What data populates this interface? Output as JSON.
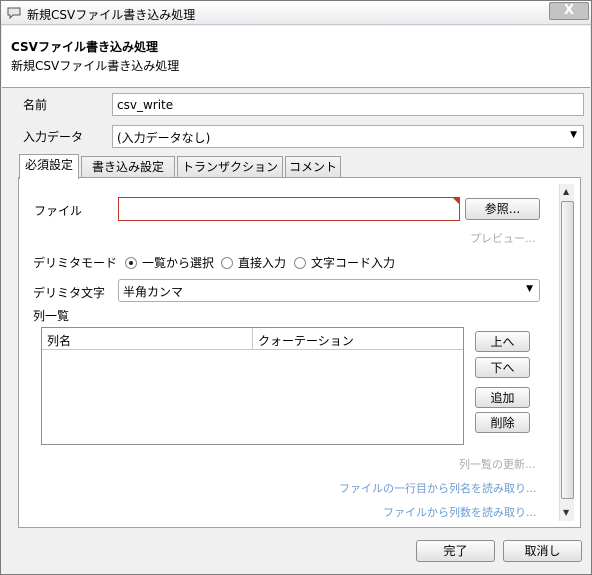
{
  "window": {
    "title": "新規CSVファイル書き込み処理",
    "close_label": "X"
  },
  "banner": {
    "title": "CSVファイル書き込み処理",
    "subtitle": "新規CSVファイル書き込み処理"
  },
  "form": {
    "name_label": "名前",
    "name_value": "csv_write",
    "input_data_label": "入力データ",
    "input_data_value": "(入力データなし)"
  },
  "tabs": [
    {
      "label": "必須設定",
      "active": true
    },
    {
      "label": "書き込み設定",
      "active": false
    },
    {
      "label": "トランザクション",
      "active": false
    },
    {
      "label": "コメント",
      "active": false
    }
  ],
  "required": {
    "file_label": "ファイル",
    "file_value": "",
    "browse_label": "参照...",
    "preview_label": "プレビュー...",
    "delimiter_mode_label": "デリミタモード",
    "radio_options": [
      {
        "label": "一覧から選択",
        "selected": true
      },
      {
        "label": "直接入力",
        "selected": false
      },
      {
        "label": "文字コード入力",
        "selected": false
      }
    ],
    "delimiter_char_label": "デリミタ文字",
    "delimiter_char_value": "半角カンマ",
    "column_list_label": "列一覧",
    "columns": [
      "列名",
      "クォーテーション"
    ],
    "up_label": "上へ",
    "down_label": "下へ",
    "add_label": "追加",
    "delete_label": "削除",
    "refresh_list_label": "列一覧の更新...",
    "read_names_label": "ファイルの一行目から列名を読み取り...",
    "read_count_label": "ファイルから列数を読み取り..."
  },
  "footer": {
    "ok_label": "完了",
    "cancel_label": "取消し"
  },
  "colors": {
    "link": "#6b9bd2",
    "required_border": "#c0392b"
  }
}
